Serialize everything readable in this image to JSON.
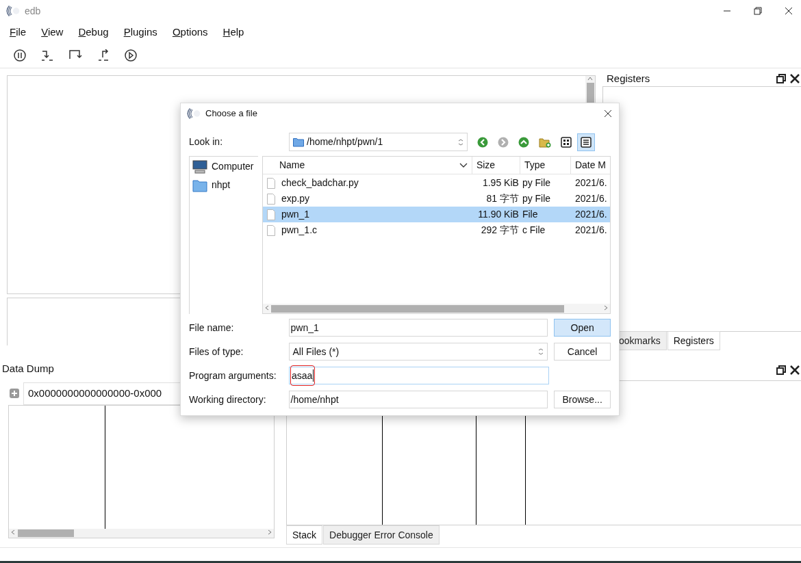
{
  "window": {
    "title": "edb"
  },
  "menu": [
    "File",
    "View",
    "Debug",
    "Plugins",
    "Options",
    "Help"
  ],
  "registers_dock": {
    "title": "Registers",
    "tabs": [
      {
        "label": "ookmarks",
        "selected": false
      },
      {
        "label": "Registers",
        "selected": true
      }
    ]
  },
  "data_dump": {
    "title": "Data Dump",
    "tab": "0x0000000000000000-0x000"
  },
  "stack_dock": {
    "tabs": [
      {
        "label": "Stack",
        "selected": true
      },
      {
        "label": "Debugger Error Console",
        "selected": false
      }
    ]
  },
  "dialog": {
    "title": "Choose a file",
    "look_in": {
      "label": "Look in:",
      "path": "/home/nhpt/pwn/1"
    },
    "places": [
      {
        "kind": "computer",
        "label": "Computer"
      },
      {
        "kind": "folder",
        "label": "nhpt"
      }
    ],
    "columns": [
      "Name",
      "Size",
      "Type",
      "Date M"
    ],
    "files": [
      {
        "name": "check_badchar.py",
        "size": "1.95 KiB",
        "type": "py File",
        "date": "2021/6.",
        "selected": false
      },
      {
        "name": "exp.py",
        "size": "81 字节",
        "type": "py File",
        "date": "2021/6.",
        "selected": false
      },
      {
        "name": "pwn_1",
        "size": "11.90 KiB",
        "type": "File",
        "date": "2021/6.",
        "selected": true
      },
      {
        "name": "pwn_1.c",
        "size": "292 字节",
        "type": "c File",
        "date": "2021/6.",
        "selected": false
      }
    ],
    "fields": [
      {
        "kind": "text",
        "label": "File name:",
        "value": "pwn_1",
        "button": "Open",
        "default": true
      },
      {
        "kind": "combo",
        "label": "Files of type:",
        "value": "All Files (*)",
        "button": "Cancel",
        "default": false
      },
      {
        "kind": "text",
        "label": "Program arguments:",
        "value": "asaa",
        "highlighted": true
      },
      {
        "kind": "text",
        "label": "Working directory:",
        "value": "/home/nhpt",
        "button": "Browse...",
        "default": false
      }
    ]
  }
}
